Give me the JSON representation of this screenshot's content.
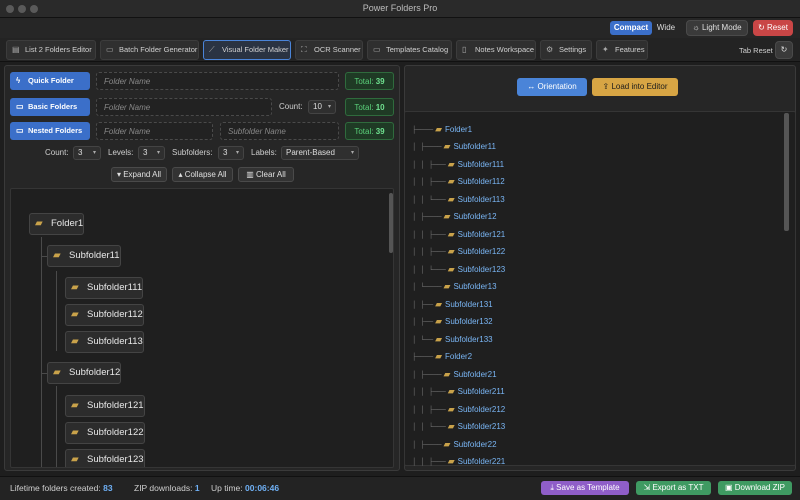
{
  "window": {
    "title": "Power Folders Pro"
  },
  "toolbar": {
    "compact_label": "Compact",
    "wide_label": "Wide",
    "light_mode_label": "Light Mode",
    "reset_label": "Reset"
  },
  "tabs": [
    {
      "label": "List 2 Folders Editor",
      "icon": "list-icon"
    },
    {
      "label": "Batch Folder Generator",
      "icon": "folder-icon"
    },
    {
      "label": "Visual Folder Maker",
      "icon": "wand-icon",
      "active": true
    },
    {
      "label": "OCR Scanner",
      "icon": "scan-icon"
    },
    {
      "label": "Templates Catalog",
      "icon": "folder-icon"
    },
    {
      "label": "Notes Workspace",
      "icon": "note-icon"
    },
    {
      "label": "Settings",
      "icon": "gear-icon"
    },
    {
      "label": "Features",
      "icon": "sparkle-icon"
    }
  ],
  "tab_reset_label": "Tab Reset",
  "left": {
    "quick": {
      "label": "Quick Folder",
      "placeholder": "Folder Name",
      "total_label": "Total:",
      "total": "39"
    },
    "basic": {
      "label": "Basic Folders",
      "placeholder": "Folder Name",
      "count_label": "Count:",
      "count": "10",
      "total_label": "Total:",
      "total": "10"
    },
    "nested": {
      "label": "Nested Folders",
      "placeholder": "Folder Name",
      "sub_placeholder": "Subfolder Name",
      "total_label": "Total:",
      "total": "39"
    },
    "options": {
      "count_label": "Count:",
      "count": "3",
      "levels_label": "Levels:",
      "levels": "3",
      "subfolders_label": "Subfolders:",
      "subfolders": "3",
      "labels_label": "Labels:",
      "labels": "Parent-Based"
    },
    "actions": {
      "expand": "▾ Expand All",
      "collapse": "▴ Collapse All",
      "clear": "Clear All"
    },
    "visual_tree": [
      {
        "name": "Folder1"
      },
      {
        "name": "Subfolder11"
      },
      {
        "name": "Subfolder111"
      },
      {
        "name": "Subfolder112"
      },
      {
        "name": "Subfolder113"
      },
      {
        "name": "Subfolder12"
      },
      {
        "name": "Subfolder121"
      },
      {
        "name": "Subfolder122"
      },
      {
        "name": "Subfolder123"
      }
    ]
  },
  "right": {
    "orientation_label": "Orientation",
    "load_label": "Load into Editor",
    "tree": [
      {
        "prefix": "├────",
        "name": "Folder1"
      },
      {
        "prefix": "│ ├────",
        "name": "Subfolder11"
      },
      {
        "prefix": "│ │ ├───",
        "name": "Subfolder111"
      },
      {
        "prefix": "│ │ ├───",
        "name": "Subfolder112"
      },
      {
        "prefix": "│ │ └───",
        "name": "Subfolder113"
      },
      {
        "prefix": "│ ├────",
        "name": "Subfolder12"
      },
      {
        "prefix": "│ │ ├───",
        "name": "Subfolder121"
      },
      {
        "prefix": "│ │ ├───",
        "name": "Subfolder122"
      },
      {
        "prefix": "│ │ └───",
        "name": "Subfolder123"
      },
      {
        "prefix": "│ └────",
        "name": "Subfolder13"
      },
      {
        "prefix": "│   ├──",
        "name": "Subfolder131"
      },
      {
        "prefix": "│   ├──",
        "name": "Subfolder132"
      },
      {
        "prefix": "│   └──",
        "name": "Subfolder133"
      },
      {
        "prefix": "├────",
        "name": "Folder2"
      },
      {
        "prefix": "│ ├────",
        "name": "Subfolder21"
      },
      {
        "prefix": "│ │ ├───",
        "name": "Subfolder211"
      },
      {
        "prefix": "│ │ ├───",
        "name": "Subfolder212"
      },
      {
        "prefix": "│ │ └───",
        "name": "Subfolder213"
      },
      {
        "prefix": "│ ├────",
        "name": "Subfolder22"
      },
      {
        "prefix": "│ │ ├───",
        "name": "Subfolder221"
      }
    ]
  },
  "status": {
    "lifetime_label": "Lifetime folders created:",
    "lifetime": "83",
    "zip_label": "ZIP downloads:",
    "zip": "1",
    "uptime_label": "Up time:",
    "uptime": "00:06:46"
  },
  "footer": {
    "save_template": "Save as Template",
    "export_txt": "Export as TXT",
    "download_zip": "Download ZIP"
  }
}
